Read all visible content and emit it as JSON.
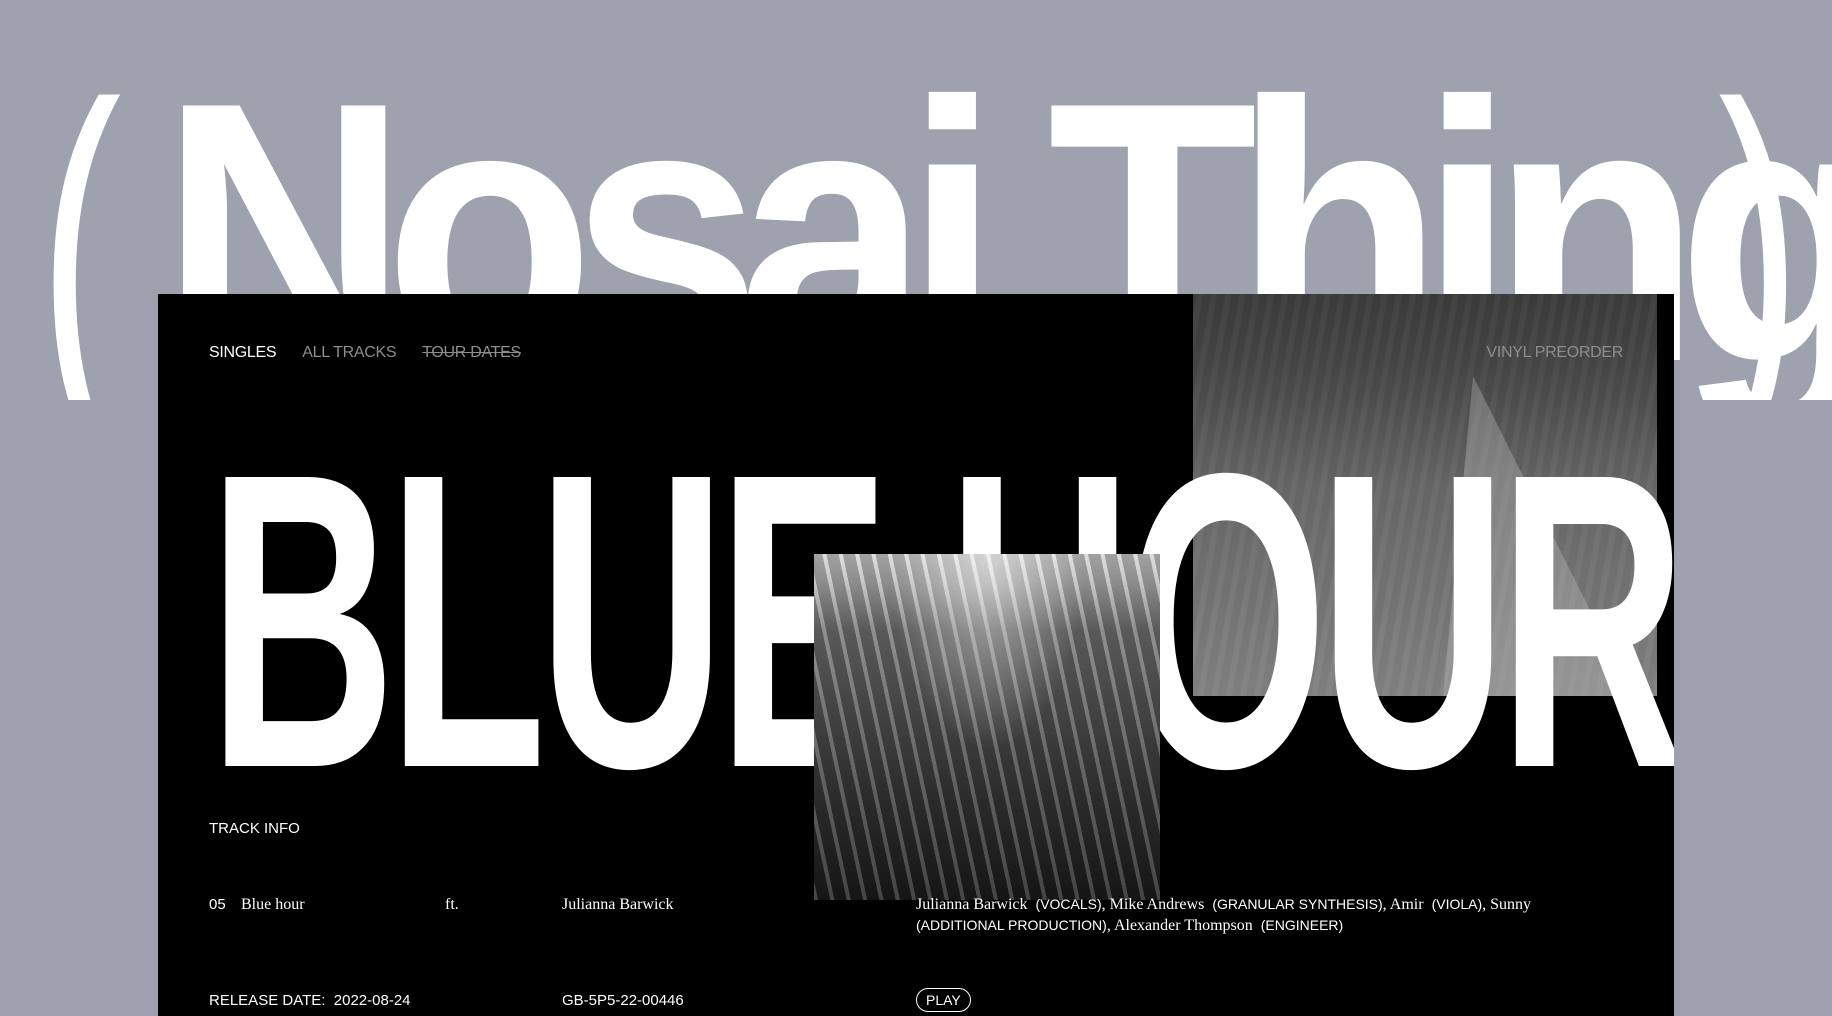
{
  "artist": {
    "open_paren": "(",
    "name": "Nosai Thing",
    "close_paren": ")"
  },
  "nav": {
    "items": [
      {
        "label": "SINGLES",
        "state": "active"
      },
      {
        "label": "ALL TRACKS",
        "state": "inactive"
      },
      {
        "label": "TOUR DATES",
        "state": "struck-through"
      }
    ],
    "preorder_label": "VINYL PREORDER"
  },
  "title": "BLUE HOUR",
  "track_info": {
    "section_label": "TRACK INFO",
    "number": "05",
    "name": "Blue hour",
    "ft_label": "ft.",
    "featuring": "Julianna Barwick",
    "credits": [
      {
        "name": "Julianna Barwick",
        "role": "(VOCALS)"
      },
      {
        "name": "Mike Andrews",
        "role": "(GRANULAR SYNTHESIS)"
      },
      {
        "name": "Amir",
        "role": "(VIOLA)"
      },
      {
        "name": "Sunny",
        "role": "(ADDITIONAL PRODUCTION)"
      },
      {
        "name": "Alexander Thompson",
        "role": "(ENGINEER)"
      }
    ],
    "release_label": "RELEASE DATE:",
    "release_date": "2022-08-24",
    "isrc": "GB-5P5-22-00446",
    "play_label": "PLAY"
  },
  "colors": {
    "background": "#9da2ae",
    "panel": "#000000",
    "text_primary": "#ffffff",
    "text_muted": "#8d8d8d"
  }
}
